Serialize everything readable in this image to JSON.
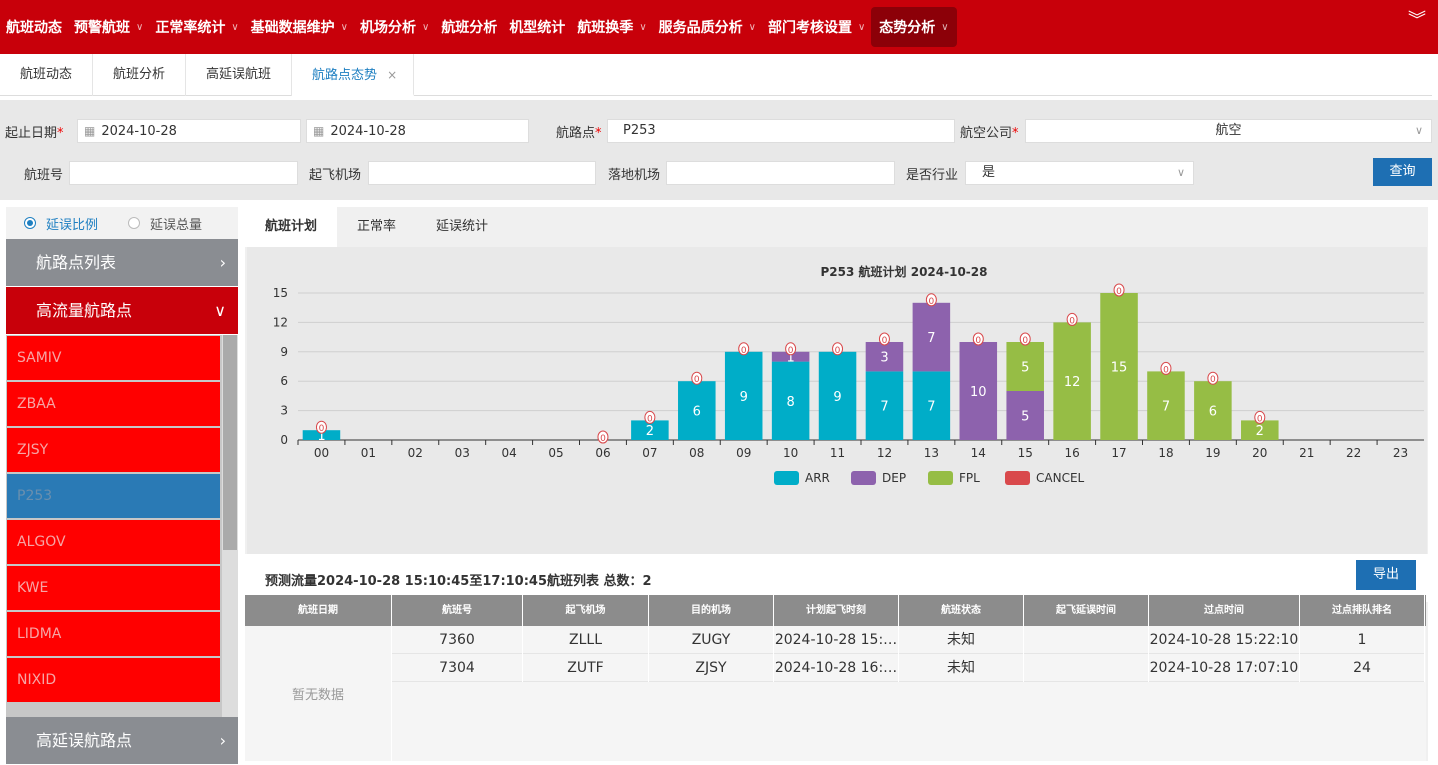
{
  "topnav": {
    "items": [
      {
        "label": "航班动态",
        "caret": false
      },
      {
        "label": "预警航班",
        "caret": true
      },
      {
        "label": "正常率统计",
        "caret": true
      },
      {
        "label": "基础数据维护",
        "caret": true
      },
      {
        "label": "机场分析",
        "caret": true
      },
      {
        "label": "航班分析",
        "caret": false
      },
      {
        "label": "机型统计",
        "caret": false
      },
      {
        "label": "航班换季",
        "caret": true
      },
      {
        "label": "服务品质分析",
        "caret": true
      },
      {
        "label": "部门考核设置",
        "caret": true
      },
      {
        "label": "态势分析",
        "caret": true,
        "active": true
      }
    ],
    "menu_icon": "double-chevron-down-icon"
  },
  "tabs": [
    {
      "label": "航班动态"
    },
    {
      "label": "航班分析"
    },
    {
      "label": "高延误航班"
    },
    {
      "label": "航路点态势",
      "active": true,
      "close": "×"
    }
  ],
  "filter": {
    "date_label": "起止日期",
    "date_start": "2024-10-28",
    "date_end": "2024-10-28",
    "point_label": "航路点",
    "point_value": "P253",
    "airline_label": "航空公司",
    "airline_value": "航空",
    "flight_label": "航班号",
    "flight_value": "",
    "dep_label": "起飞机场",
    "dep_value": "",
    "arr_label": "落地机场",
    "arr_value": "",
    "industry_label": "是否行业",
    "industry_value": "是",
    "query_label": "查询",
    "required_mark": "*"
  },
  "sidebar": {
    "radio_ratio": "延误比例",
    "radio_total": "延误总量",
    "section_list": "航路点列表",
    "section_high_flow": "高流量航路点",
    "section_high_delay": "高延误航路点",
    "items": [
      "SAMIV",
      "ZBAA",
      "ZJSY",
      "P253",
      "ALGOV",
      "KWE",
      "LIDMA",
      "NIXID"
    ],
    "selected": "P253"
  },
  "content_tabs": [
    {
      "label": "航班计划",
      "active": true
    },
    {
      "label": "正常率"
    },
    {
      "label": "延误统计"
    }
  ],
  "chart_data": {
    "type": "bar",
    "stacked": true,
    "title": "P253 航班计划 2024-10-28",
    "categories": [
      "00",
      "01",
      "02",
      "03",
      "04",
      "05",
      "06",
      "07",
      "08",
      "09",
      "10",
      "11",
      "12",
      "13",
      "14",
      "15",
      "16",
      "17",
      "18",
      "19",
      "20",
      "21",
      "22",
      "23"
    ],
    "ylim": [
      0,
      15
    ],
    "yticks": [
      0,
      3,
      6,
      9,
      12,
      15
    ],
    "series": [
      {
        "name": "ARR",
        "color": "#00adc8",
        "values": [
          1,
          0,
          0,
          0,
          0,
          0,
          0,
          2,
          6,
          9,
          8,
          9,
          7,
          7,
          0,
          0,
          0,
          0,
          0,
          0,
          0,
          0,
          0,
          0
        ]
      },
      {
        "name": "DEP",
        "color": "#8d62ad",
        "values": [
          0,
          0,
          0,
          0,
          0,
          0,
          0,
          0,
          0,
          0,
          1,
          0,
          3,
          7,
          10,
          5,
          0,
          0,
          0,
          0,
          0,
          0,
          0,
          0
        ]
      },
      {
        "name": "FPL",
        "color": "#96bd45",
        "values": [
          0,
          0,
          0,
          0,
          0,
          0,
          0,
          0,
          0,
          0,
          0,
          0,
          0,
          0,
          0,
          5,
          12,
          15,
          7,
          6,
          2,
          0,
          0,
          0
        ]
      },
      {
        "name": "CANCEL",
        "color": "#d9494c",
        "values": [
          0,
          0,
          0,
          0,
          0,
          0,
          0,
          0,
          0,
          0,
          0,
          0,
          0,
          0,
          0,
          0,
          0,
          0,
          0,
          0,
          0,
          0,
          0,
          0
        ]
      }
    ],
    "cancel_markers_at": [
      "00",
      "06",
      "07",
      "08",
      "09",
      "10",
      "11",
      "12",
      "13",
      "14",
      "15",
      "16",
      "17",
      "18",
      "19",
      "20"
    ],
    "legend_position": "bottom",
    "grid": true
  },
  "list": {
    "title": "预测流量2024-10-28 15:10:45至17:10:45航班列表 总数：2",
    "export_label": "导出",
    "columns": [
      "航班日期",
      "航班号",
      "起飞机场",
      "目的机场",
      "计划起飞时刻",
      "航班状态",
      "起飞延误时间",
      "过点时间",
      "过点排队排名"
    ],
    "no_data": "暂无数据",
    "rows": [
      [
        "7360",
        "ZLLL",
        "ZUGY",
        "2024-10-28 15:…",
        "未知",
        "",
        "2024-10-28 15:22:10",
        "1"
      ],
      [
        "7304",
        "ZUTF",
        "ZJSY",
        "2024-10-28 16:…",
        "未知",
        "",
        "2024-10-28 17:07:10",
        "24"
      ]
    ]
  }
}
